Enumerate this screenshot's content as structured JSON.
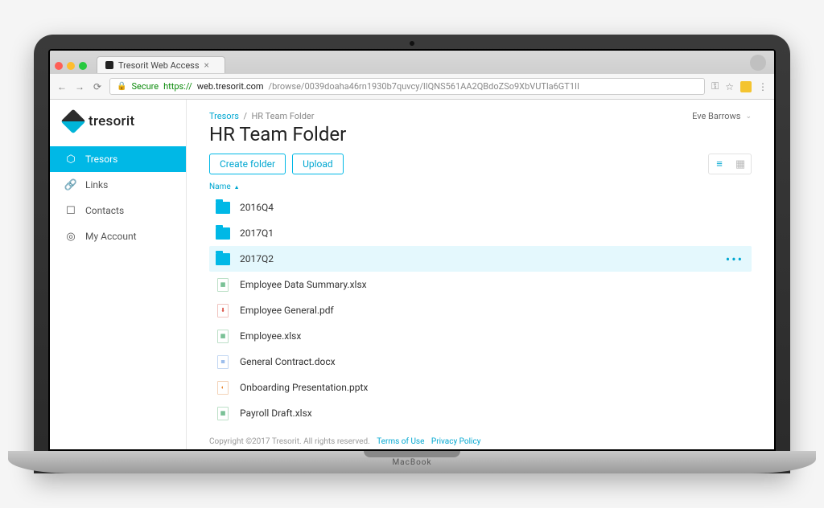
{
  "browser": {
    "tab_title": "Tresorit Web Access",
    "secure_label": "Secure",
    "url_scheme": "https://",
    "url_host": "web.tresorit.com",
    "url_path": "/browse/0039doaha46rn1930b7quvcy/lIQNS561AA2QBdoZSo9XbVUTla6GT1II"
  },
  "brand": {
    "name": "tresorit"
  },
  "sidebar": {
    "items": [
      {
        "label": "Tresors",
        "icon": "hexagon-icon",
        "active": true
      },
      {
        "label": "Links",
        "icon": "link-icon",
        "active": false
      },
      {
        "label": "Contacts",
        "icon": "contact-icon",
        "active": false
      },
      {
        "label": "My Account",
        "icon": "user-icon",
        "active": false
      }
    ]
  },
  "breadcrumb": {
    "root": "Tresors",
    "current": "HR Team Folder"
  },
  "user": {
    "name": "Eve Barrows"
  },
  "page": {
    "title": "HR Team Folder"
  },
  "toolbar": {
    "create_folder": "Create folder",
    "upload": "Upload"
  },
  "list": {
    "sort_label": "Name",
    "items": [
      {
        "name": "2016Q4",
        "type": "folder",
        "selected": false
      },
      {
        "name": "2017Q1",
        "type": "folder",
        "selected": false
      },
      {
        "name": "2017Q2",
        "type": "folder",
        "selected": true
      },
      {
        "name": "Employee Data Summary.xlsx",
        "type": "xls",
        "selected": false
      },
      {
        "name": "Employee General.pdf",
        "type": "pdf",
        "selected": false
      },
      {
        "name": "Employee.xlsx",
        "type": "xls",
        "selected": false
      },
      {
        "name": "General Contract.docx",
        "type": "docx",
        "selected": false
      },
      {
        "name": "Onboarding Presentation.pptx",
        "type": "pptx",
        "selected": false
      },
      {
        "name": "Payroll Draft.xlsx",
        "type": "xls",
        "selected": false
      }
    ]
  },
  "footer": {
    "copyright": "Copyright ©2017 Tresorit. All rights reserved.",
    "terms": "Terms of Use",
    "privacy": "Privacy Policy"
  },
  "glyphs": {
    "hexagon": "⬡",
    "link": "🔗",
    "contact": "☐",
    "user": "◎",
    "list": "≡",
    "grid": "▦",
    "sort_asc": "▲",
    "xls": "▦",
    "pdf": "⬇",
    "docx": "≣",
    "pptx": "◐",
    "macbook": "MacBook"
  }
}
